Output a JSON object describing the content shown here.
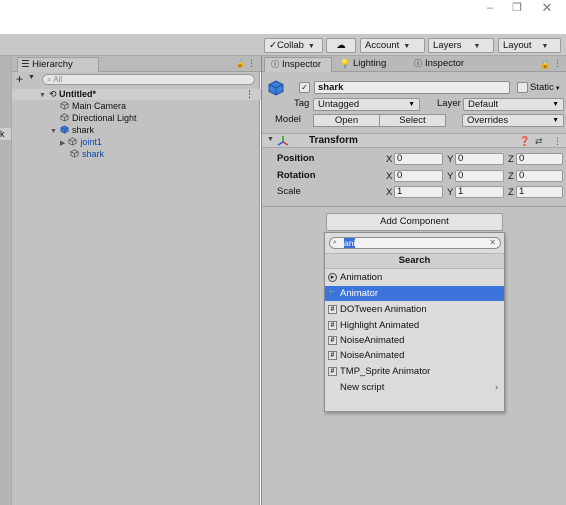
{
  "window": {
    "minimize": "–",
    "maximize": "❐",
    "close": "✕"
  },
  "toolbar": {
    "collab": "Collab",
    "account": "Account",
    "layers": "Layers",
    "layout": "Layout"
  },
  "hierarchy": {
    "tab_label": "Hierarchy",
    "search_placeholder": "All",
    "scene": "Untitled*",
    "items": [
      "Main Camera",
      "Directional Light",
      "shark",
      "joint1",
      "shark"
    ]
  },
  "inspector": {
    "tabs": [
      "Inspector",
      "Lighting",
      "Inspector"
    ],
    "object_name": "shark",
    "static_label": "Static",
    "tag_label": "Tag",
    "tag_value": "Untagged",
    "layer_label": "Layer",
    "layer_value": "Default",
    "model_label": "Model",
    "open_button": "Open",
    "select_button": "Select",
    "overrides": "Overrides",
    "transform": {
      "title": "Transform",
      "rows": [
        {
          "label": "Position",
          "x": "0",
          "y": "0",
          "z": "0"
        },
        {
          "label": "Rotation",
          "x": "0",
          "y": "0",
          "z": "0"
        },
        {
          "label": "Scale",
          "x": "1",
          "y": "1",
          "z": "1"
        }
      ],
      "axes": [
        "X",
        "Y",
        "Z"
      ]
    },
    "add_component": "Add Component"
  },
  "popup": {
    "search_text": "ani",
    "header": "Search",
    "items": [
      {
        "label": "Animation",
        "icon": "animation-icon"
      },
      {
        "label": "Animator",
        "icon": "animator-icon",
        "highlighted": true
      },
      {
        "label": "DOTween Animation",
        "icon": "script-icon"
      },
      {
        "label": "Highlight Animated",
        "icon": "script-icon"
      },
      {
        "label": "NoiseAnimated",
        "icon": "script-icon"
      },
      {
        "label": "NoiseAnimated",
        "icon": "script-icon"
      },
      {
        "label": "TMP_Sprite Animator",
        "icon": "script-icon"
      },
      {
        "label": "New script",
        "icon": "none"
      }
    ]
  },
  "colors": {
    "highlight": "#3c74dc",
    "prefab_blue": "#0e46a8",
    "panel": "#c2c2c2"
  }
}
